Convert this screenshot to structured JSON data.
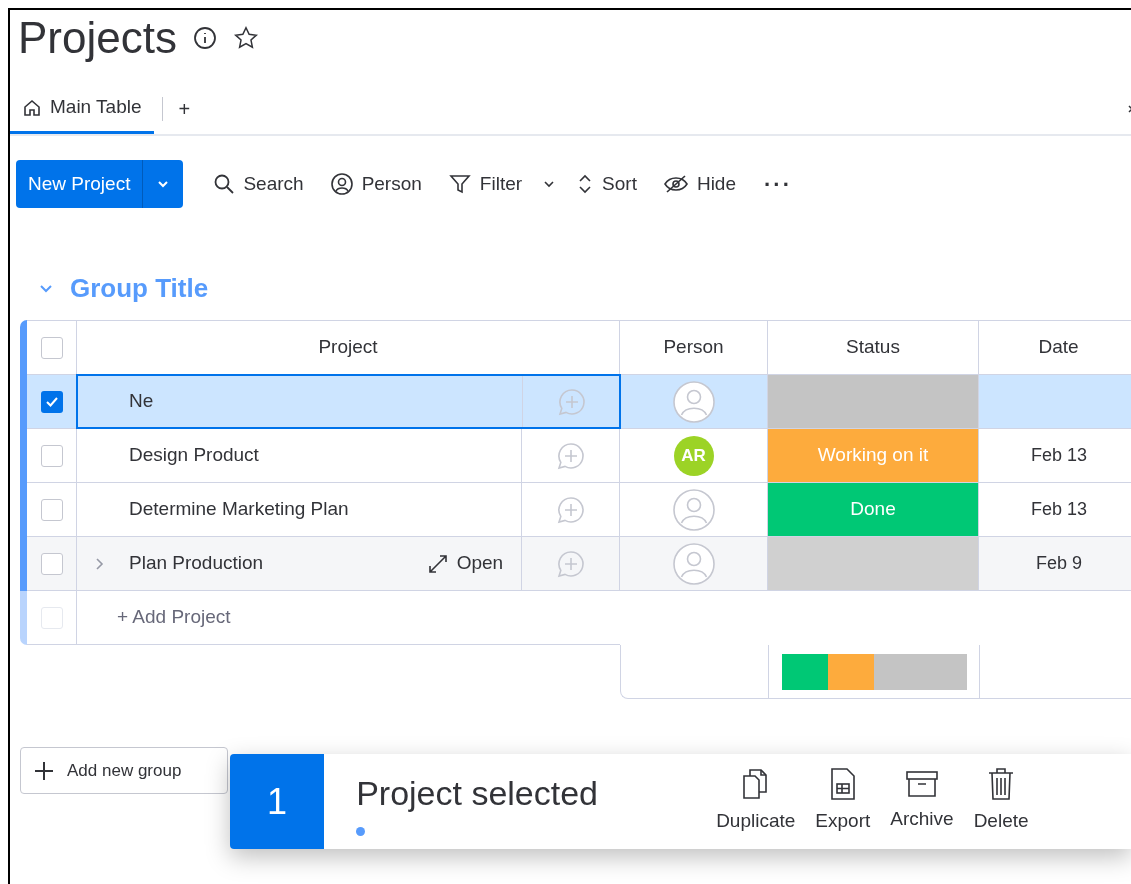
{
  "board": {
    "title": "Projects"
  },
  "tabs": [
    {
      "label": "Main Table",
      "selected": true
    }
  ],
  "add_tab": "+",
  "toolbar": {
    "primary": "New Project",
    "items": [
      {
        "kind": "search",
        "label": "Search"
      },
      {
        "kind": "person",
        "label": "Person"
      },
      {
        "kind": "filter",
        "label": "Filter"
      },
      {
        "kind": "sort",
        "label": "Sort"
      },
      {
        "kind": "hide",
        "label": "Hide"
      }
    ],
    "more": "···"
  },
  "group": {
    "title": "Group Title",
    "expanded": true
  },
  "table": {
    "columns": [
      "Project",
      "Person",
      "Status",
      "Date"
    ],
    "all_checked": false,
    "add_row_checked": false,
    "rows": [
      {
        "name": "Ne",
        "selected": true,
        "hovered": false,
        "person": {
          "kind": "empty"
        },
        "status": {
          "kind": "blank",
          "color": "#c4c4c4"
        }
      },
      {
        "name": "Design Product",
        "selected": false,
        "hovered": false,
        "person": {
          "kind": "initials",
          "initials": "AR",
          "color": "#9cd326"
        },
        "status": {
          "kind": "working",
          "label": "Working on it",
          "color": "#fdab3d"
        },
        "date": "Feb 13"
      },
      {
        "name": "Determine Marketing Plan",
        "selected": false,
        "hovered": false,
        "person": {
          "kind": "empty"
        },
        "status": {
          "kind": "done",
          "label": "Done",
          "color": "#00c875"
        },
        "date": "Feb 13"
      },
      {
        "name": "Plan Production",
        "selected": false,
        "hovered": true,
        "open_label": "Open",
        "person": {
          "kind": "empty"
        },
        "status": {
          "kind": "blank",
          "color": "#d0d0d0"
        },
        "date": "Feb 9"
      }
    ],
    "add_row": "+ Add Project",
    "status_summary": [
      {
        "kind": "done",
        "color": "#00c875"
      },
      {
        "kind": "working",
        "color": "#fdab3d"
      },
      {
        "kind": "blank",
        "color": "#c4c4c4"
      }
    ]
  },
  "add_group": "Add new group",
  "selection_bar": {
    "count": "1",
    "label": "Project selected",
    "actions": [
      {
        "kind": "duplicate",
        "label": "Duplicate"
      },
      {
        "kind": "export",
        "label": "Export"
      },
      {
        "kind": "archive",
        "label": "Archive"
      },
      {
        "kind": "delete",
        "label": "Delete"
      }
    ]
  }
}
